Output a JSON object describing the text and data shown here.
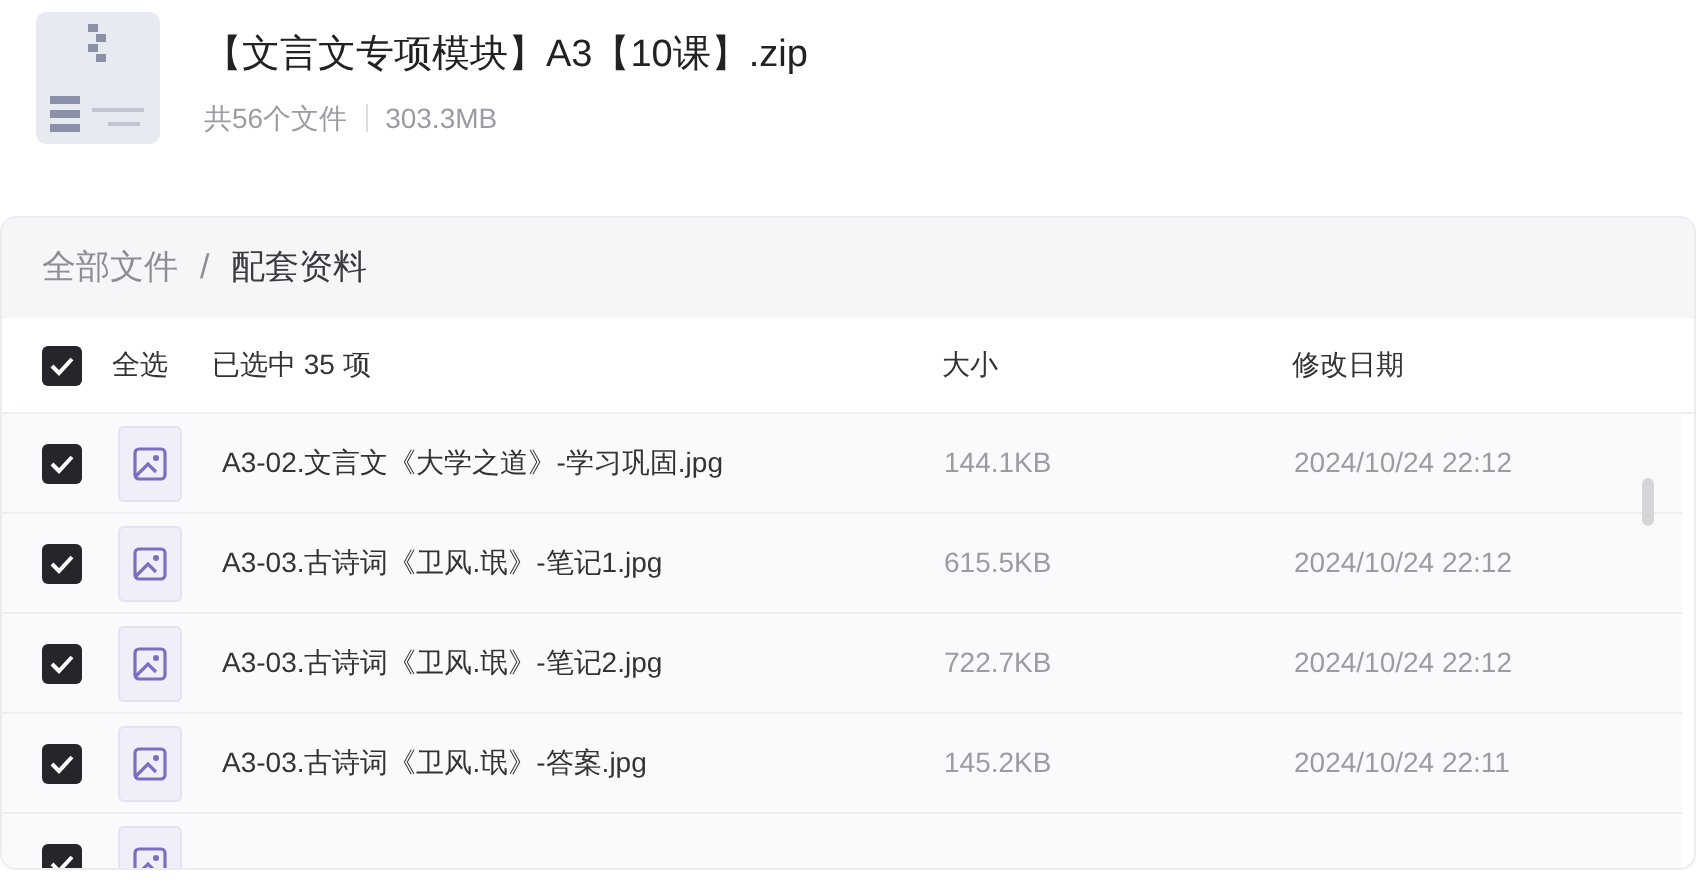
{
  "archive": {
    "title": "【文言文专项模块】A3【10课】.zip",
    "file_count": "共56个文件",
    "size": "303.3MB"
  },
  "breadcrumb": [
    {
      "label": "全部文件",
      "selected": false
    },
    {
      "label": "配套资料",
      "selected": true
    }
  ],
  "breadcrumb_separator": "/",
  "table": {
    "select_all": {
      "label": "全选",
      "checked": true
    },
    "selection_info": "已选中 35 项",
    "columns": [
      "大小",
      "修改日期"
    ],
    "rows": [
      {
        "name": "A3-02.文言文《大学之道》-学习巩固.jpg",
        "size": "144.1KB",
        "date": "2024/10/24 22:12",
        "checked": true
      },
      {
        "name": "A3-03.古诗词《卫风.氓》-笔记1.jpg",
        "size": "615.5KB",
        "date": "2024/10/24 22:12",
        "checked": true
      },
      {
        "name": "A3-03.古诗词《卫风.氓》-笔记2.jpg",
        "size": "722.7KB",
        "date": "2024/10/24 22:12",
        "checked": true
      },
      {
        "name": "A3-03.古诗词《卫风.氓》-答案.jpg",
        "size": "145.2KB",
        "date": "2024/10/24 22:11",
        "checked": true
      },
      {
        "checked": true
      }
    ]
  }
}
